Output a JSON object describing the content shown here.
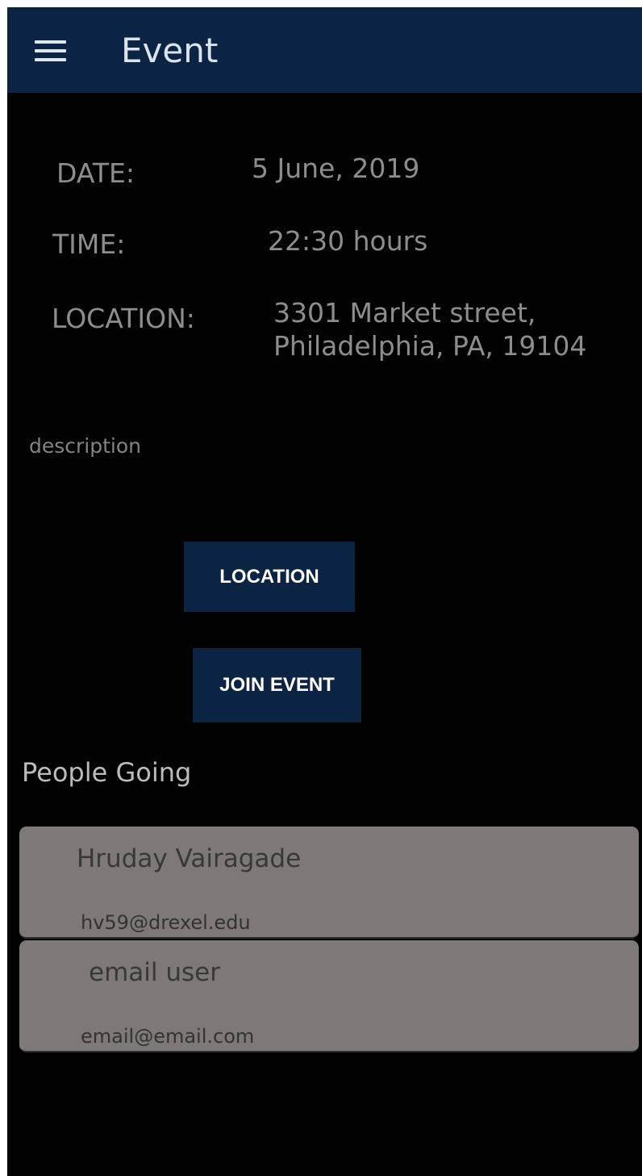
{
  "appbar": {
    "title": "Event",
    "menu_icon": "hamburger-menu-icon"
  },
  "details": {
    "date_label": "DATE:",
    "date_value": "5 June, 2019",
    "time_label": "TIME:",
    "time_value": "22:30 hours",
    "location_label": "LOCATION:",
    "location_value": "3301 Market street,\nPhiladelphia, PA, 19104"
  },
  "description": "description",
  "buttons": {
    "location_label": "LOCATION",
    "join_event_label": "JOIN EVENT"
  },
  "people_going": {
    "title": "People Going",
    "people": [
      {
        "name": "Hruday Vairagade",
        "email": "hv59@drexel.edu"
      },
      {
        "name": "email user",
        "email": "email@email.com"
      }
    ]
  },
  "colors": {
    "background": "#020203",
    "appbar": "#0b2443",
    "button": "#0b2443",
    "card": "#7f7878",
    "text_muted": "#8d8d8d"
  }
}
